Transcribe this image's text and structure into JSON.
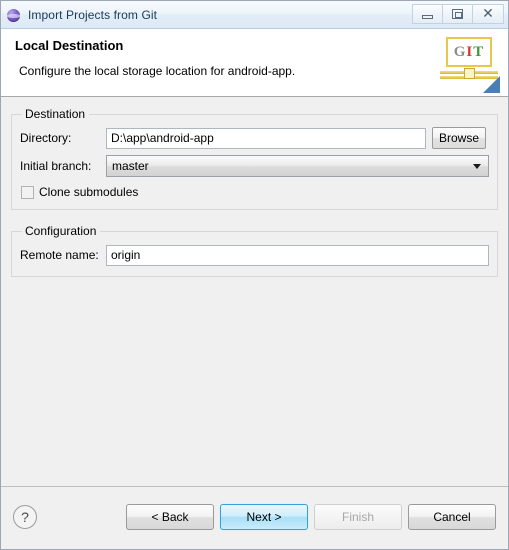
{
  "window": {
    "title": "Import Projects from Git",
    "icon": "git-import-icon",
    "controls": {
      "minimize": "minimize-icon",
      "maximize": "restore-icon",
      "close": "close-icon"
    }
  },
  "header": {
    "title": "Local Destination",
    "description": "Configure the local storage location for android-app.",
    "logo": {
      "letters": [
        "G",
        "I",
        "T"
      ],
      "colors": {
        "g": "#8d8d8d",
        "i": "#d03a2e",
        "t": "#3f9a3f",
        "frame": "#e8c84a",
        "triangle": "#4a7fb5"
      }
    }
  },
  "form": {
    "destination": {
      "legend": "Destination",
      "directory_label": "Directory:",
      "directory_value": "D:\\app\\android-app",
      "directory_placeholder": "",
      "browse_label": "Browse",
      "branch_label": "Initial branch:",
      "branch_value": "master",
      "branch_options": [
        "master"
      ],
      "clone_submodules_label": "Clone submodules",
      "clone_submodules_checked": false
    },
    "configuration": {
      "legend": "Configuration",
      "remote_label": "Remote name:",
      "remote_value": "origin",
      "remote_placeholder": ""
    }
  },
  "footer": {
    "help": "?",
    "back_label": "< Back",
    "next_label": "Next >",
    "finish_label": "Finish",
    "cancel_label": "Cancel",
    "finish_disabled": true,
    "default_button": "Next >",
    "accent_color": "#3c9fd4"
  }
}
